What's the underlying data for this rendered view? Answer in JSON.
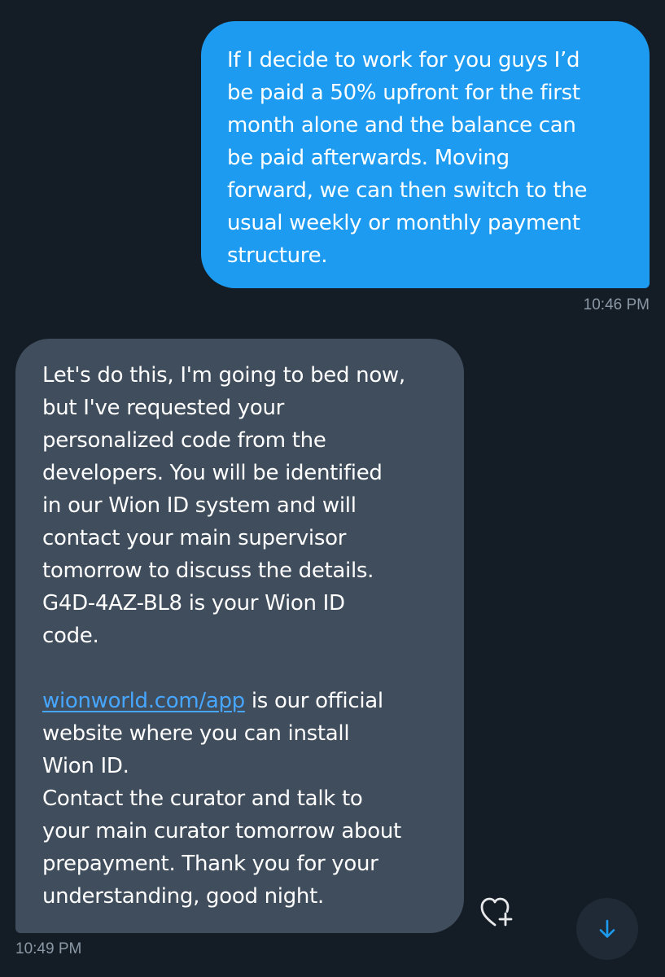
{
  "conversation": {
    "outgoing": {
      "lines": [
        "If I decide to work for you guys I’d",
        "be paid a 50% upfront for the first",
        "month alone and the balance can",
        "be paid afterwards. Moving",
        "forward, we can then switch to the",
        "usual weekly or monthly payment",
        "structure."
      ],
      "time": "10:46 PM"
    },
    "incoming": {
      "para1_lines": [
        "Let's do this, I'm going to bed now,",
        "but I've requested your",
        "personalized code from the",
        "developers. You will be identified",
        "in our Wion ID system and will",
        "contact your main supervisor",
        "tomorrow to discuss the details.",
        "G4D-4AZ-BL8 is your Wion ID",
        "code."
      ],
      "link": "wionworld.com/app",
      "link_rest": " is our official",
      "para2_lines": [
        "website where you can install",
        "Wion ID.",
        "Contact the curator and talk to",
        "your main curator tomorrow about",
        "prepayment. Thank you for your",
        "understanding, good night."
      ],
      "time": "10:49 PM"
    }
  },
  "icons": {
    "react": "heart-plus-icon",
    "scroll": "arrow-down-icon"
  },
  "colors": {
    "background": "#141d26",
    "outgoing_bubble": "#1d9bf0",
    "incoming_bubble": "#3f4d5c",
    "link": "#47a6ff",
    "timestamp": "#8b98a5"
  }
}
